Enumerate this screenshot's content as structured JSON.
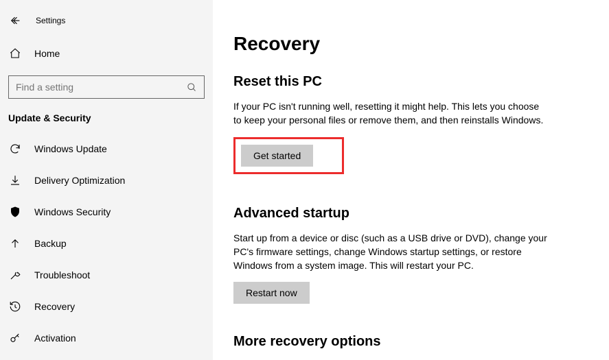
{
  "header": {
    "settings_label": "Settings",
    "home_label": "Home"
  },
  "search": {
    "placeholder": "Find a setting"
  },
  "category": {
    "label": "Update & Security"
  },
  "nav": {
    "items": [
      {
        "label": "Windows Update"
      },
      {
        "label": "Delivery Optimization"
      },
      {
        "label": "Windows Security"
      },
      {
        "label": "Backup"
      },
      {
        "label": "Troubleshoot"
      },
      {
        "label": "Recovery"
      },
      {
        "label": "Activation"
      }
    ]
  },
  "main": {
    "title": "Recovery",
    "reset": {
      "heading": "Reset this PC",
      "body": "If your PC isn't running well, resetting it might help. This lets you choose to keep your personal files or remove them, and then reinstalls Windows.",
      "button": "Get started"
    },
    "advanced": {
      "heading": "Advanced startup",
      "body": "Start up from a device or disc (such as a USB drive or DVD), change your PC's firmware settings, change Windows startup settings, or restore Windows from a system image. This will restart your PC.",
      "button": "Restart now"
    },
    "more": {
      "heading": "More recovery options"
    }
  }
}
